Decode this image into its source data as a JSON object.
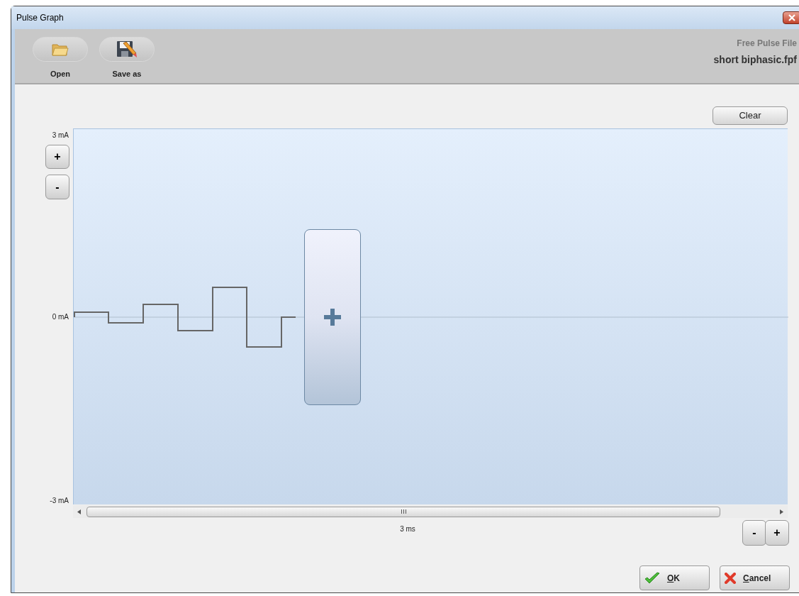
{
  "window": {
    "title": "Pulse Graph"
  },
  "toolbar": {
    "buttons": [
      {
        "label": "Open",
        "kind": "open"
      },
      {
        "label": "Save as",
        "kind": "save"
      }
    ],
    "file_caption": "Free Pulse File",
    "file_name": "short biphasic.fpf"
  },
  "graph": {
    "clear_button": "Clear",
    "y_labels": [
      "3 mA",
      "0 mA",
      "-3 mA"
    ],
    "y_zoom_buttons": [
      "+",
      "-"
    ],
    "x_label": "3 ms",
    "x_zoom_buttons": [
      "-",
      "+"
    ]
  },
  "footer_buttons": [
    {
      "label": "OK",
      "kind": "ok"
    },
    {
      "label": "Cancel",
      "kind": "cancel"
    }
  ]
}
